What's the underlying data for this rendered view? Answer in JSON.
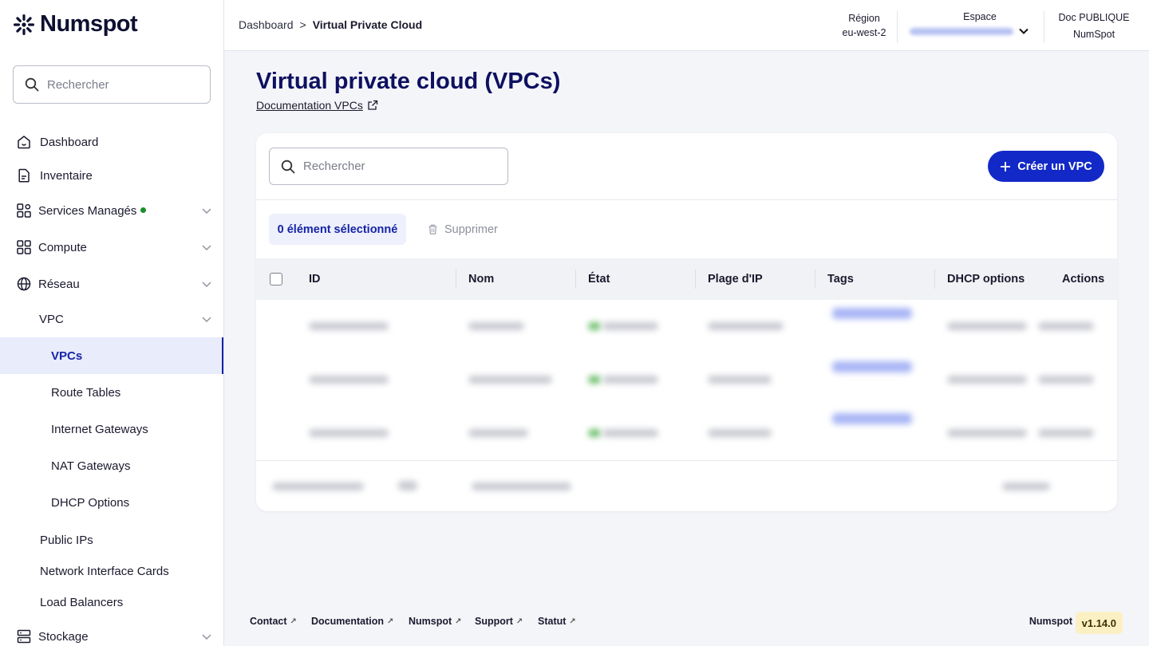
{
  "app": {
    "brand": "Numspot"
  },
  "sidebar": {
    "search_placeholder": "Rechercher",
    "items": [
      {
        "label": "Dashboard",
        "icon": "home-icon"
      },
      {
        "label": "Inventaire",
        "icon": "document-icon"
      },
      {
        "label": "Services Managés",
        "icon": "services-icon",
        "status_dot": "green"
      },
      {
        "label": "Compute",
        "icon": "grid-icon"
      },
      {
        "label": "Réseau",
        "icon": "globe-icon"
      },
      {
        "label": "VPC"
      },
      {
        "label": "VPCs",
        "active": true
      },
      {
        "label": "Route Tables"
      },
      {
        "label": "Internet Gateways"
      },
      {
        "label": "NAT Gateways"
      },
      {
        "label": "DHCP Options"
      },
      {
        "label": "Public IPs"
      },
      {
        "label": "Network Interface Cards"
      },
      {
        "label": "Load Balancers"
      },
      {
        "label": "Stockage",
        "icon": "storage-icon"
      }
    ]
  },
  "topbar": {
    "breadcrumb": [
      "Dashboard",
      "Virtual Private Cloud"
    ],
    "breadcrumb_sep": ">",
    "region_label": "Région",
    "region_value": "eu-west-2",
    "space_label": "Espace",
    "doc_label": "Doc PUBLIQUE",
    "doc_value": "NumSpot"
  },
  "page": {
    "title": "Virtual private cloud (VPCs)",
    "doc_link": "Documentation VPCs"
  },
  "table": {
    "search_placeholder": "Rechercher",
    "create_button": "Créer un VPC",
    "selected_count": "0 élément sélectionné",
    "delete_button": "Supprimer",
    "columns": [
      "ID",
      "Nom",
      "État",
      "Plage d'IP",
      "Tags",
      "DHCP options",
      "Actions"
    ]
  },
  "footer": {
    "links": [
      "Contact",
      "Documentation",
      "Numspot",
      "Support",
      "Statut"
    ],
    "brand": "Numspot",
    "version": "v1.14.0"
  },
  "colors": {
    "primary": "#1229c7",
    "title": "#0e1060",
    "active_bg": "#e9ecfb",
    "status_green": "#1a8f2a",
    "version_bg": "#fbf0c4"
  }
}
